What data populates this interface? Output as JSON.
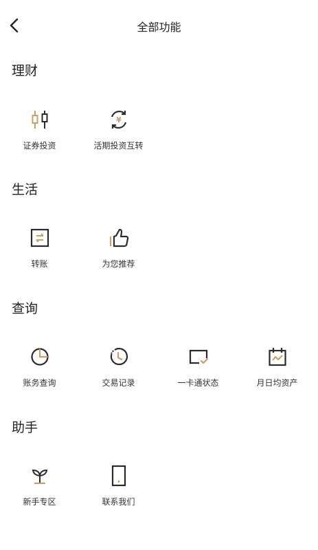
{
  "header": {
    "title": "全部功能"
  },
  "colors": {
    "accent": "#C9A064",
    "icon": "#2a2a2a",
    "text": "#222222"
  },
  "sections": [
    {
      "title": "理财",
      "items": [
        {
          "label": "证券投资",
          "icon": "candlestick-icon"
        },
        {
          "label": "活期投资互转",
          "icon": "yen-cycle-icon"
        }
      ]
    },
    {
      "title": "生活",
      "items": [
        {
          "label": "转账",
          "icon": "transfer-icon"
        },
        {
          "label": "为您推荐",
          "icon": "thumbs-up-icon"
        }
      ]
    },
    {
      "title": "查询",
      "items": [
        {
          "label": "账务查询",
          "icon": "pie-chart-icon"
        },
        {
          "label": "交易记录",
          "icon": "history-clock-icon"
        },
        {
          "label": "一卡通状态",
          "icon": "card-check-icon"
        },
        {
          "label": "月日均资产",
          "icon": "calendar-chart-icon"
        }
      ]
    },
    {
      "title": "助手",
      "items": [
        {
          "label": "新手专区",
          "icon": "sprout-icon"
        },
        {
          "label": "联系我们",
          "icon": "phone-icon"
        }
      ]
    }
  ]
}
